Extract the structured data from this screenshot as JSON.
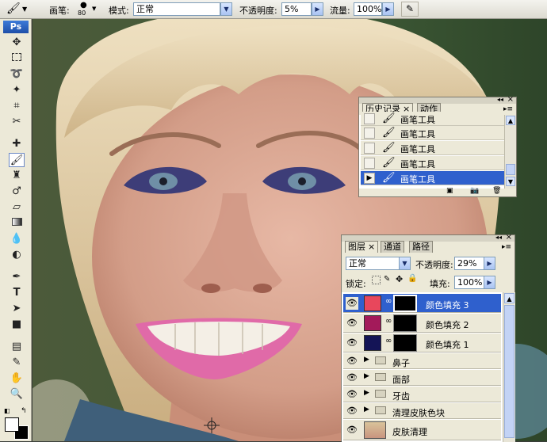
{
  "options_bar": {
    "brush_label": "画笔:",
    "brush_size": "80",
    "mode_label": "模式:",
    "mode_value": "正常",
    "opacity_label": "不透明度:",
    "opacity_value": "5%",
    "flow_label": "流量:",
    "flow_value": "100%"
  },
  "toolbox": {
    "logo": "Ps"
  },
  "history_panel": {
    "tabs": [
      {
        "label": "历史记录",
        "active": true
      },
      {
        "label": "动作",
        "active": false
      }
    ],
    "items": [
      {
        "label": "画笔工具",
        "selected": false
      },
      {
        "label": "画笔工具",
        "selected": false
      },
      {
        "label": "画笔工具",
        "selected": false
      },
      {
        "label": "画笔工具",
        "selected": false
      },
      {
        "label": "画笔工具",
        "selected": true
      }
    ]
  },
  "layers_panel": {
    "tabs": [
      {
        "label": "图层",
        "active": true
      },
      {
        "label": "通道",
        "active": false
      },
      {
        "label": "路径",
        "active": false
      }
    ],
    "blend_mode": "正常",
    "opacity_label": "不透明度:",
    "opacity_value": "29%",
    "lock_label": "锁定:",
    "fill_label": "填充:",
    "fill_value": "100%",
    "layers": [
      {
        "name": "颜色填充 3",
        "swatch": "#e8475c",
        "selected": true,
        "type": "fill"
      },
      {
        "name": "颜色填充 2",
        "swatch": "#a31a5a",
        "selected": false,
        "type": "fill"
      },
      {
        "name": "颜色填充 1",
        "swatch": "#141456",
        "selected": false,
        "type": "fill"
      },
      {
        "name": "鼻子",
        "selected": false,
        "type": "group"
      },
      {
        "name": "面部",
        "selected": false,
        "type": "group"
      },
      {
        "name": "牙齿",
        "selected": false,
        "type": "group"
      },
      {
        "name": "清理皮肤色块",
        "selected": false,
        "type": "group"
      },
      {
        "name": "皮肤清理",
        "selected": false,
        "type": "image"
      }
    ]
  }
}
